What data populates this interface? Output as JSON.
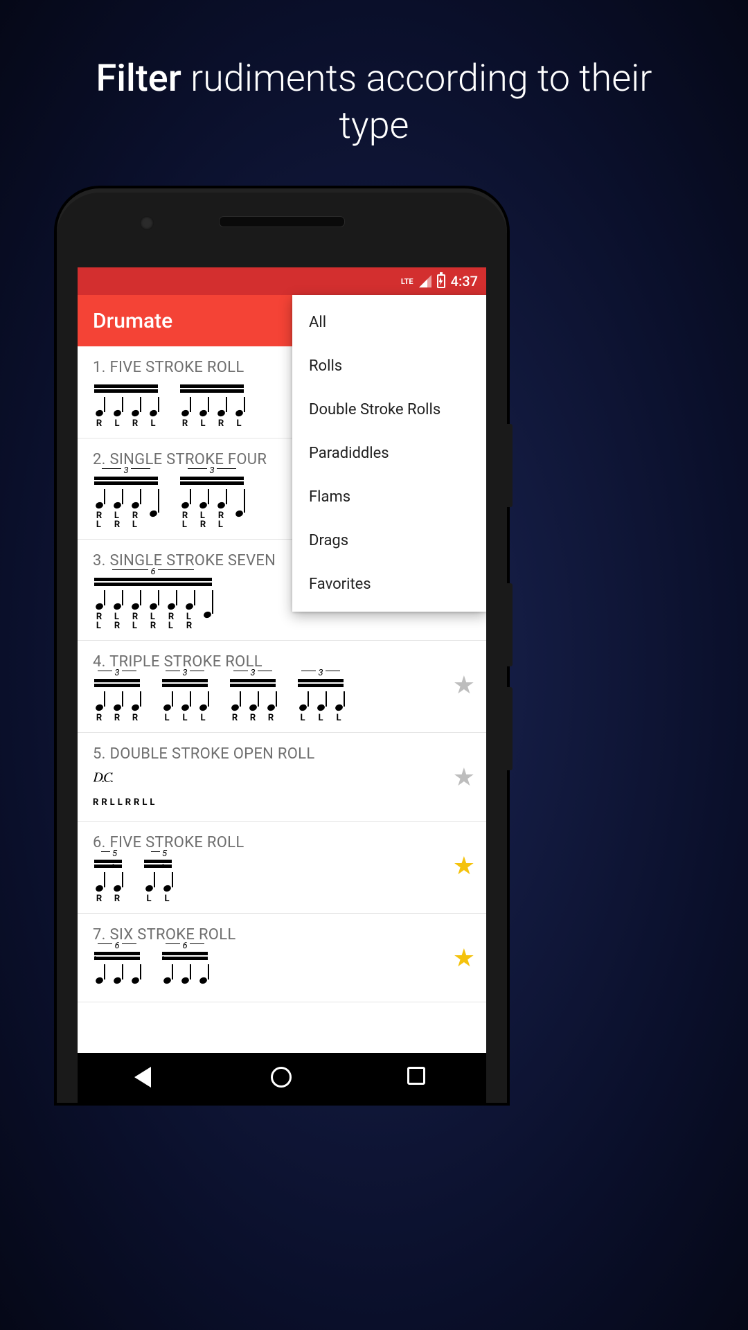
{
  "tagline": {
    "bold": "Filter",
    "rest": " rudiments according to their type"
  },
  "status": {
    "network": "LTE",
    "time": "4:37"
  },
  "app": {
    "title": "Drumate"
  },
  "menu": {
    "items": [
      "All",
      "Rolls",
      "Double Stroke Rolls",
      "Paradiddles",
      "Flams",
      "Drags",
      "Favorites"
    ]
  },
  "list": [
    {
      "title": "1. FIVE STROKE ROLL",
      "groups": [
        {
          "letters": [
            "R",
            "L",
            "R",
            "L"
          ],
          "beam": true
        },
        {
          "letters": [
            "R",
            "L",
            "R",
            "L"
          ],
          "beam": true
        }
      ],
      "fav": false
    },
    {
      "title": "2. SINGLE STROKE FOUR",
      "groups": [
        {
          "tuplet": "3",
          "letters_stacked": [
            [
              "R",
              "L"
            ],
            [
              "L",
              "R"
            ],
            [
              "R",
              "L"
            ]
          ],
          "beam": true,
          "trailing": true
        },
        {
          "tuplet": "3",
          "letters_stacked": [
            [
              "R",
              "L"
            ],
            [
              "L",
              "R"
            ],
            [
              "R",
              "L"
            ]
          ],
          "beam": true,
          "trailing": true
        }
      ],
      "fav": false
    },
    {
      "title": "3. SINGLE STROKE SEVEN",
      "groups": [
        {
          "tuplet": "6",
          "letters_stacked": [
            [
              "R",
              "L"
            ],
            [
              "L",
              "R"
            ],
            [
              "R",
              "L"
            ],
            [
              "L",
              "R"
            ],
            [
              "R",
              "L"
            ],
            [
              "L",
              "R"
            ]
          ],
          "beam": true,
          "trailing": true
        }
      ],
      "fav": false
    },
    {
      "title": "4. TRIPLE STROKE ROLL",
      "groups": [
        {
          "tuplet": "3",
          "letters": [
            "R",
            "R",
            "R"
          ],
          "beam": true
        },
        {
          "tuplet": "3",
          "letters": [
            "L",
            "L",
            "L"
          ],
          "beam": true
        },
        {
          "tuplet": "3",
          "letters": [
            "R",
            "R",
            "R"
          ],
          "beam": true
        },
        {
          "tuplet": "3",
          "letters": [
            "L",
            "L",
            "L"
          ],
          "beam": true
        }
      ],
      "fav": false
    },
    {
      "title": "5. DOUBLE STROKE OPEN ROLL",
      "roll_letters": "RRLLRRLL",
      "fav": false
    },
    {
      "title": "6. FIVE STROKE ROLL",
      "groups": [
        {
          "tuplet": "5",
          "letters": [
            "R",
            "R"
          ],
          "beam": true,
          "accent_last": true
        },
        {
          "tuplet": "5",
          "letters": [
            "L",
            "L"
          ],
          "beam": true,
          "accent_last": true
        }
      ],
      "fav": true
    },
    {
      "title": "7. SIX STROKE ROLL",
      "groups": [
        {
          "tuplet": "6",
          "letters": [],
          "beam": true,
          "accent_first": true
        },
        {
          "tuplet": "6",
          "letters": [],
          "beam": true,
          "accent_first": true
        }
      ],
      "fav": true
    }
  ]
}
